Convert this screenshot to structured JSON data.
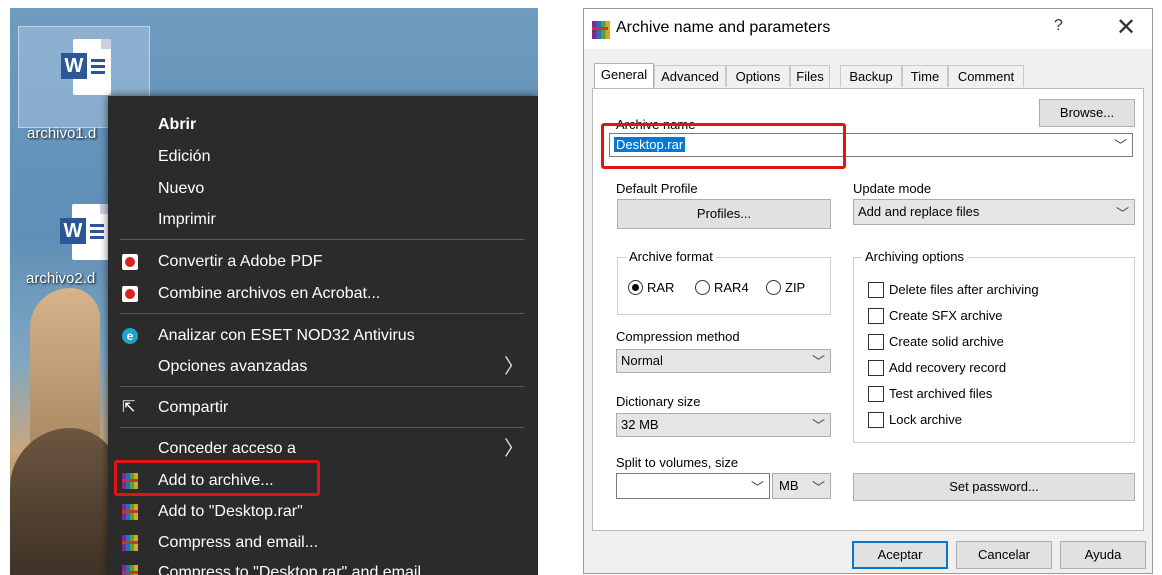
{
  "desktop": {
    "icons": [
      {
        "label": "archivo1.d",
        "icon": "word-doc-icon"
      },
      {
        "label": "archivo2.d",
        "icon": "word-doc-icon"
      }
    ],
    "word_badge": "W"
  },
  "context_menu": {
    "items": [
      {
        "label": "Abrir",
        "bold": true
      },
      {
        "label": "Edición"
      },
      {
        "label": "Nuevo"
      },
      {
        "label": "Imprimir"
      },
      {
        "label": "Convertir a Adobe PDF",
        "icon": "adobe-pdf-icon"
      },
      {
        "label": "Combine archivos en Acrobat...",
        "icon": "acrobat-combine-icon"
      },
      {
        "label": "Analizar con ESET NOD32 Antivirus",
        "icon": "eset-icon"
      },
      {
        "label": "Opciones avanzadas",
        "submenu": true
      },
      {
        "label": "Compartir",
        "icon": "share-icon"
      },
      {
        "label": "Conceder acceso a",
        "submenu": true
      },
      {
        "label": "Add to archive...",
        "icon": "winrar-icon",
        "highlighted": true
      },
      {
        "label": "Add to \"Desktop.rar\"",
        "icon": "winrar-icon"
      },
      {
        "label": "Compress and email...",
        "icon": "winrar-icon"
      },
      {
        "label": "Compress to \"Desktop.rar\" and email",
        "icon": "winrar-icon"
      }
    ],
    "arrow": "〉",
    "eset_glyph": "e",
    "share_glyph": "⇱"
  },
  "dialog": {
    "title": "Archive name and parameters",
    "help": "?",
    "close": "✕",
    "tabs": [
      "General",
      "Advanced",
      "Options",
      "Files",
      "Backup",
      "Time",
      "Comment"
    ],
    "active_tab": "General",
    "archive_name_label": "Archive name",
    "archive_name_value": "Desktop.rar",
    "browse_button": "Browse...",
    "default_profile_label": "Default Profile",
    "profiles_button": "Profiles...",
    "update_mode_label": "Update mode",
    "update_mode_value": "Add and replace files",
    "archive_format": {
      "title": "Archive format",
      "options": [
        "RAR",
        "RAR4",
        "ZIP"
      ],
      "selected": "RAR"
    },
    "compression_method_label": "Compression method",
    "compression_method_value": "Normal",
    "dictionary_size_label": "Dictionary size",
    "dictionary_size_value": "32 MB",
    "split_label": "Split to volumes, size",
    "split_value": "",
    "split_unit": "MB",
    "archiving_options": {
      "title": "Archiving options",
      "items": [
        {
          "label": "Delete files after archiving",
          "checked": false
        },
        {
          "label": "Create SFX archive",
          "checked": false
        },
        {
          "label": "Create solid archive",
          "checked": false
        },
        {
          "label": "Add recovery record",
          "checked": false
        },
        {
          "label": "Test archived files",
          "checked": false
        },
        {
          "label": "Lock archive",
          "checked": false
        }
      ]
    },
    "set_password_button": "Set password...",
    "ok_button": "Aceptar",
    "cancel_button": "Cancelar",
    "help_button": "Ayuda",
    "chevron": "﹀"
  },
  "colors": {
    "highlight": "#e01414",
    "menu_bg": "#2b2b2b",
    "selection": "#0078d7",
    "dialog_bg": "#f0f0f0"
  }
}
